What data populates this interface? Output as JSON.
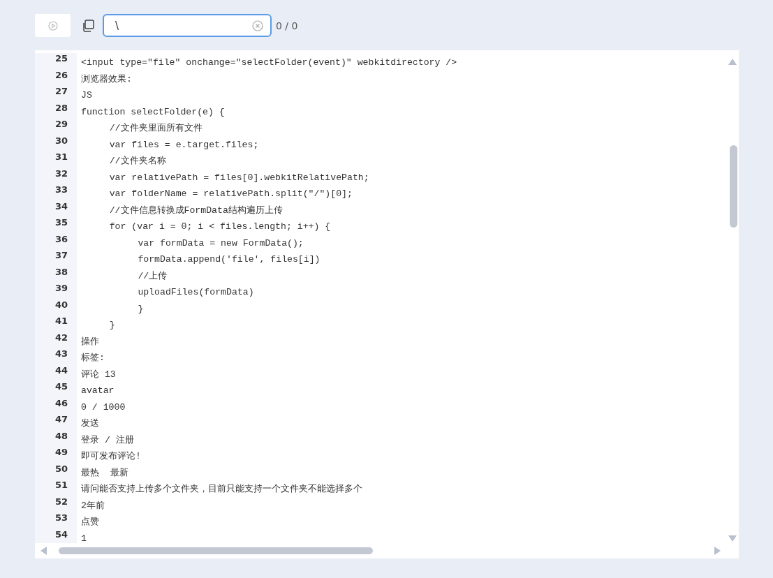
{
  "toolbar": {
    "search": {
      "value": "\\"
    },
    "match_count": "0 / 0"
  },
  "editor": {
    "lines": [
      {
        "number": "25",
        "text": "<input type=\"file\" onchange=\"selectFolder(event)\" webkitdirectory />"
      },
      {
        "number": "26",
        "text": "浏览器效果:"
      },
      {
        "number": "27",
        "text": "JS"
      },
      {
        "number": "28",
        "text": "function selectFolder(e) {"
      },
      {
        "number": "29",
        "text": "\t//文件夹里面所有文件"
      },
      {
        "number": "30",
        "text": "\tvar files = e.target.files;"
      },
      {
        "number": "31",
        "text": "\t//文件夹名称"
      },
      {
        "number": "32",
        "text": "\tvar relativePath = files[0].webkitRelativePath;"
      },
      {
        "number": "33",
        "text": "\tvar folderName = relativePath.split(\"/\")[0];"
      },
      {
        "number": "34",
        "text": "\t//文件信息转换成FormData结构遍历上传"
      },
      {
        "number": "35",
        "text": "\tfor (var i = 0; i < files.length; i++) {"
      },
      {
        "number": "36",
        "text": "\t\tvar formData = new FormData();"
      },
      {
        "number": "37",
        "text": "\t\tformData.append('file', files[i])"
      },
      {
        "number": "38",
        "text": "\t\t//上传"
      },
      {
        "number": "39",
        "text": "\t\tuploadFiles(formData)"
      },
      {
        "number": "40",
        "text": "\t\t}"
      },
      {
        "number": "41",
        "text": "\t}"
      },
      {
        "number": "42",
        "text": "操作"
      },
      {
        "number": "43",
        "text": "标签:"
      },
      {
        "number": "44",
        "text": "评论 13"
      },
      {
        "number": "45",
        "text": "avatar"
      },
      {
        "number": "46",
        "text": "0 / 1000"
      },
      {
        "number": "47",
        "text": "发送"
      },
      {
        "number": "48",
        "text": "登录 / 注册"
      },
      {
        "number": "49",
        "text": "即可发布评论!"
      },
      {
        "number": "50",
        "text": "最热  最新"
      },
      {
        "number": "51",
        "text": "请问能否支持上传多个文件夹，目前只能支持一个文件夹不能选择多个"
      },
      {
        "number": "52",
        "text": "2年前"
      },
      {
        "number": "53",
        "text": "点赞"
      },
      {
        "number": "54",
        "text": "1"
      }
    ]
  }
}
